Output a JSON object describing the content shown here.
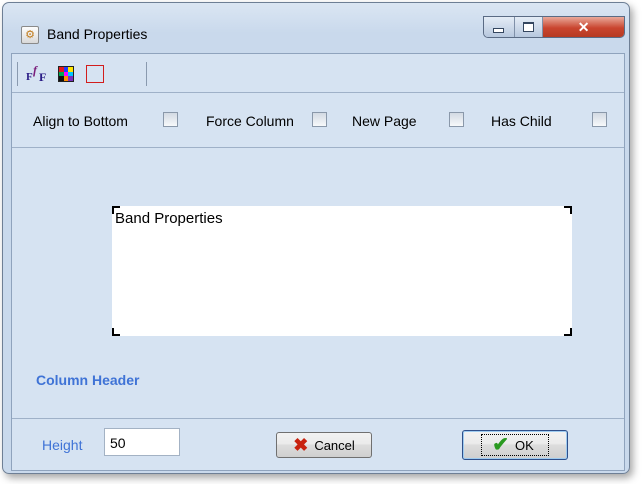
{
  "window": {
    "title": "Band Properties",
    "close_glyph": "✕"
  },
  "toolbar": {
    "font_glyph_1": "F",
    "font_glyph_2": "f",
    "font_glyph_3": "F",
    "icons": [
      "font-icon",
      "color-palette-icon",
      "border-icon"
    ],
    "palette_colors": [
      "#e31a1c",
      "#1f3cff",
      "#ffe600",
      "#00a651",
      "#ff00ff",
      "#00c8ff",
      "#111111",
      "#ff8c00",
      "#7a2fbf"
    ],
    "border_color": "#d21d1d"
  },
  "options": {
    "align_to_bottom": {
      "label": "Align to Bottom",
      "checked": false
    },
    "force_column": {
      "label": "Force Column",
      "checked": false
    },
    "new_page": {
      "label": "New Page",
      "checked": false
    },
    "has_child": {
      "label": "Has Child",
      "checked": false
    }
  },
  "preview": {
    "text": "Band Properties",
    "band_type": "Column Header"
  },
  "height": {
    "label": "Height",
    "value": "50"
  },
  "buttons": {
    "cancel": "Cancel",
    "ok": "OK",
    "accent_ok_border": "#2f4f8a"
  }
}
